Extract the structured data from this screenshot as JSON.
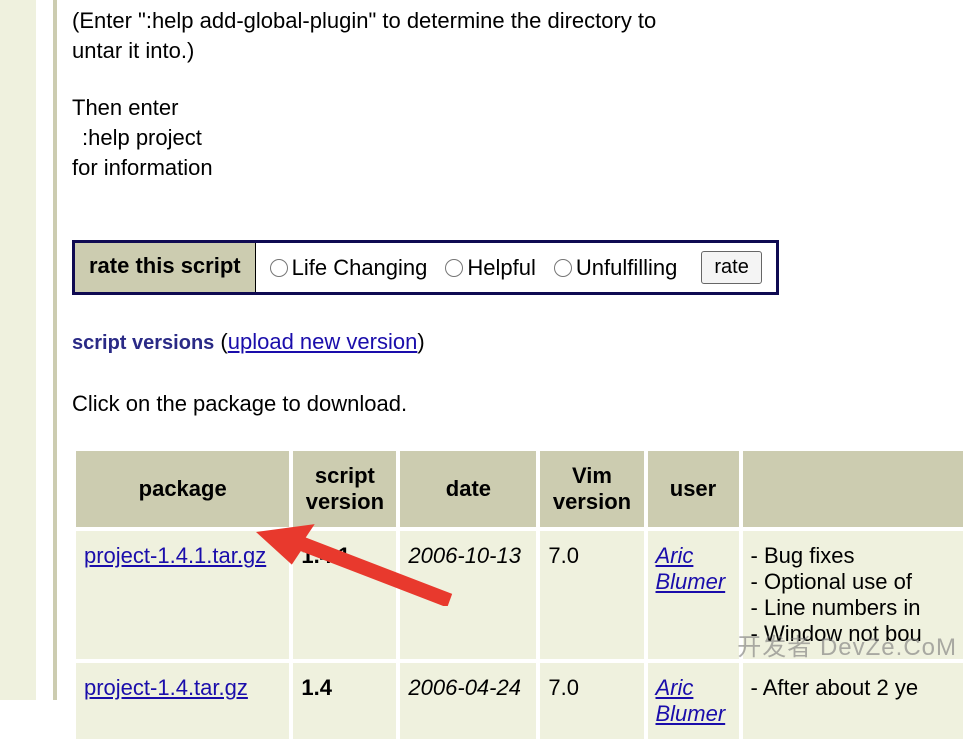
{
  "instructions": {
    "line1": "(Enter \":help add-global-plugin\" to determine the directory to",
    "line2": "untar it into.)",
    "line3": "Then enter",
    "line4": ":help project",
    "line5": "for information"
  },
  "rate": {
    "label": "rate this script",
    "option1": "Life Changing",
    "option2": "Helpful",
    "option3": "Unfulfilling",
    "button": "rate"
  },
  "versions": {
    "section_label": "script versions",
    "open_paren": " (",
    "upload_link": "upload new version",
    "close_paren": ")"
  },
  "download_hint": "Click on the package to download.",
  "table": {
    "headers": {
      "package": "package",
      "script_version": "script version",
      "date": "date",
      "vim_version": "Vim version",
      "user": "user",
      "release": ""
    },
    "rows": [
      {
        "package": "project-1.4.1.tar.gz",
        "version": "1.4.1",
        "date": "2006-10-13",
        "vim": "7.0",
        "user": "Aric Blumer",
        "notes": [
          "Bug fixes",
          "Optional use of",
          "Line numbers in",
          "Window not bou"
        ]
      },
      {
        "package": "project-1.4.tar.gz",
        "version": "1.4",
        "date": "2006-04-24",
        "vim": "7.0",
        "user": "Aric Blumer",
        "notes": [
          "After about 2 ye"
        ]
      }
    ]
  },
  "watermark": "开发者  DevZe.CoM"
}
